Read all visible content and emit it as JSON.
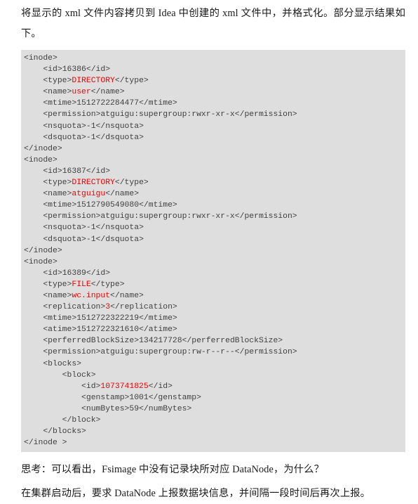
{
  "document": {
    "intro_paragraph": "将显示的 xml 文件内容拷贝到 Idea 中创建的 xml 文件中，并格式化。部分显示结果如下。",
    "code_block": {
      "language": "xml",
      "lines": [
        {
          "indent": 0,
          "before": "<inode>",
          "value": "",
          "after": ""
        },
        {
          "indent": 1,
          "before": "<id>",
          "value": "16386",
          "after": "</id>",
          "value_red": false
        },
        {
          "indent": 1,
          "before": "<type>",
          "value": "DIRECTORY",
          "after": "</type>",
          "value_red": true
        },
        {
          "indent": 1,
          "before": "<name>",
          "value": "user",
          "after": "</name>",
          "value_red": true
        },
        {
          "indent": 1,
          "before": "<mtime>",
          "value": "1512722284477",
          "after": "</mtime>",
          "value_red": false
        },
        {
          "indent": 1,
          "before": "<permission>",
          "value": "atguigu:supergroup:rwxr-xr-x",
          "after": "</permission>",
          "value_red": false
        },
        {
          "indent": 1,
          "before": "<nsquota>",
          "value": "-1",
          "after": "</nsquota>",
          "value_red": false
        },
        {
          "indent": 1,
          "before": "<dsquota>",
          "value": "-1",
          "after": "</dsquota>",
          "value_red": false
        },
        {
          "indent": 0,
          "before": "</inode>",
          "value": "",
          "after": ""
        },
        {
          "indent": 0,
          "before": "<inode>",
          "value": "",
          "after": ""
        },
        {
          "indent": 1,
          "before": "<id>",
          "value": "16387",
          "after": "</id>",
          "value_red": false
        },
        {
          "indent": 1,
          "before": "<type>",
          "value": "DIRECTORY",
          "after": "</type>",
          "value_red": true
        },
        {
          "indent": 1,
          "before": "<name>",
          "value": "atguigu",
          "after": "</name>",
          "value_red": true
        },
        {
          "indent": 1,
          "before": "<mtime>",
          "value": "1512790549080",
          "after": "</mtime>",
          "value_red": false
        },
        {
          "indent": 1,
          "before": "<permission>",
          "value": "atguigu:supergroup:rwxr-xr-x",
          "after": "</permission>",
          "value_red": false
        },
        {
          "indent": 1,
          "before": "<nsquota>",
          "value": "-1",
          "after": "</nsquota>",
          "value_red": false
        },
        {
          "indent": 1,
          "before": "<dsquota>",
          "value": "-1",
          "after": "</dsquota>",
          "value_red": false
        },
        {
          "indent": 0,
          "before": "</inode>",
          "value": "",
          "after": ""
        },
        {
          "indent": 0,
          "before": "<inode>",
          "value": "",
          "after": ""
        },
        {
          "indent": 1,
          "before": "<id>",
          "value": "16389",
          "after": "</id>",
          "value_red": false
        },
        {
          "indent": 1,
          "before": "<type>",
          "value": "FILE",
          "after": "</type>",
          "value_red": true
        },
        {
          "indent": 1,
          "before": "<name>",
          "value": "wc.input",
          "after": "</name>",
          "value_red": true
        },
        {
          "indent": 1,
          "before": "<replication>",
          "value": "3",
          "after": "</replication>",
          "value_red": true
        },
        {
          "indent": 1,
          "before": "<mtime>",
          "value": "1512722322219",
          "after": "</mtime>",
          "value_red": false
        },
        {
          "indent": 1,
          "before": "<atime>",
          "value": "1512722321610",
          "after": "</atime>",
          "value_red": false
        },
        {
          "indent": 1,
          "before": "<perferredBlockSize>",
          "value": "134217728",
          "after": "</perferredBlockSize>",
          "value_red": false
        },
        {
          "indent": 1,
          "before": "<permission>",
          "value": "atguigu:supergroup:rw-r--r--",
          "after": "</permission>",
          "value_red": false
        },
        {
          "indent": 1,
          "before": "<blocks>",
          "value": "",
          "after": ""
        },
        {
          "indent": 2,
          "before": "<block>",
          "value": "",
          "after": ""
        },
        {
          "indent": 3,
          "before": "<id>",
          "value": "1073741825",
          "after": "</id>",
          "value_red": true
        },
        {
          "indent": 3,
          "before": "<genstamp>",
          "value": "1001",
          "after": "</genstamp>",
          "value_red": false
        },
        {
          "indent": 3,
          "before": "<numBytes>",
          "value": "59",
          "after": "</numBytes>",
          "value_red": false
        },
        {
          "indent": 2,
          "before": "</block>",
          "value": "",
          "after": ""
        },
        {
          "indent": 1,
          "before": "</blocks>",
          "value": "",
          "after": ""
        },
        {
          "indent": 0,
          "before": "</inode >",
          "value": "",
          "after": ""
        }
      ]
    },
    "note_paragraph": "思考：可以看出，Fsimage 中没有记录块所对应 DataNode，为什么？",
    "answer_paragraph": "在集群启动后，要求 DataNode 上报数据块信息，并间隔一段时间后再次上报。"
  },
  "colors": {
    "code_background": "#dededf",
    "code_text": "#3f3f3f",
    "value_highlight": "#f20000",
    "body_text": "#1a1a1a"
  }
}
